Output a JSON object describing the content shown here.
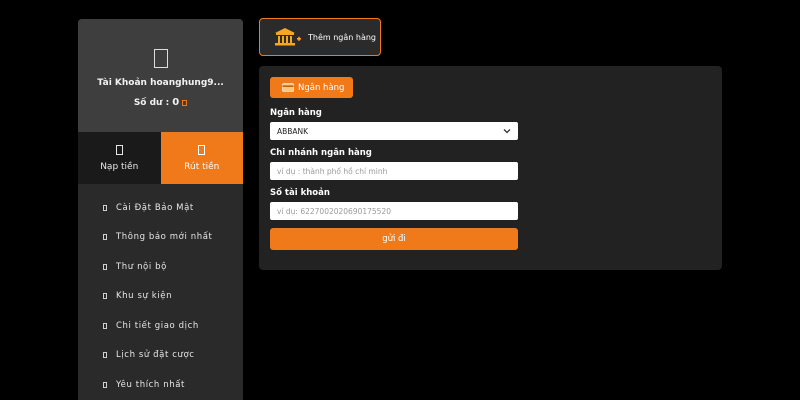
{
  "profile": {
    "account_label": "Tài Khoản hoanghung9...",
    "balance_label": "Số dư :",
    "balance_value": "0"
  },
  "tabs": {
    "deposit": "Nạp tiền",
    "withdraw": "Rút tiền"
  },
  "menu": [
    {
      "label": "Cài Đặt Bảo Mật"
    },
    {
      "label": "Thông báo mới nhất"
    },
    {
      "label": "Thư nội bộ"
    },
    {
      "label": "Khu sự kiện"
    },
    {
      "label": "Chi tiết giao dịch"
    },
    {
      "label": "Lịch sử đặt cược"
    },
    {
      "label": "Yêu thích nhất"
    }
  ],
  "add_bank_button": "Thêm ngân hàng",
  "panel": {
    "tab_label": "Ngân hàng",
    "bank_label": "Ngân hàng",
    "bank_selected": "ABBANK",
    "branch_label": "Chi nhánh ngân hàng",
    "branch_placeholder": "ví dụ : thành phố hồ chí minh",
    "account_label": "Số tài khoản",
    "account_placeholder": "ví dụ: 6227002020690175520",
    "submit_label": "gửi đi"
  },
  "colors": {
    "accent": "#f07a1a",
    "background": "#000000",
    "sidebar": "#2a2a2a",
    "profile": "#3e3e3e",
    "panel": "#222222"
  },
  "icons": [
    "avatar-icon",
    "coin-icon",
    "deposit-icon",
    "withdraw-icon",
    "bank-add-icon",
    "card-icon",
    "chevron-down-icon"
  ]
}
